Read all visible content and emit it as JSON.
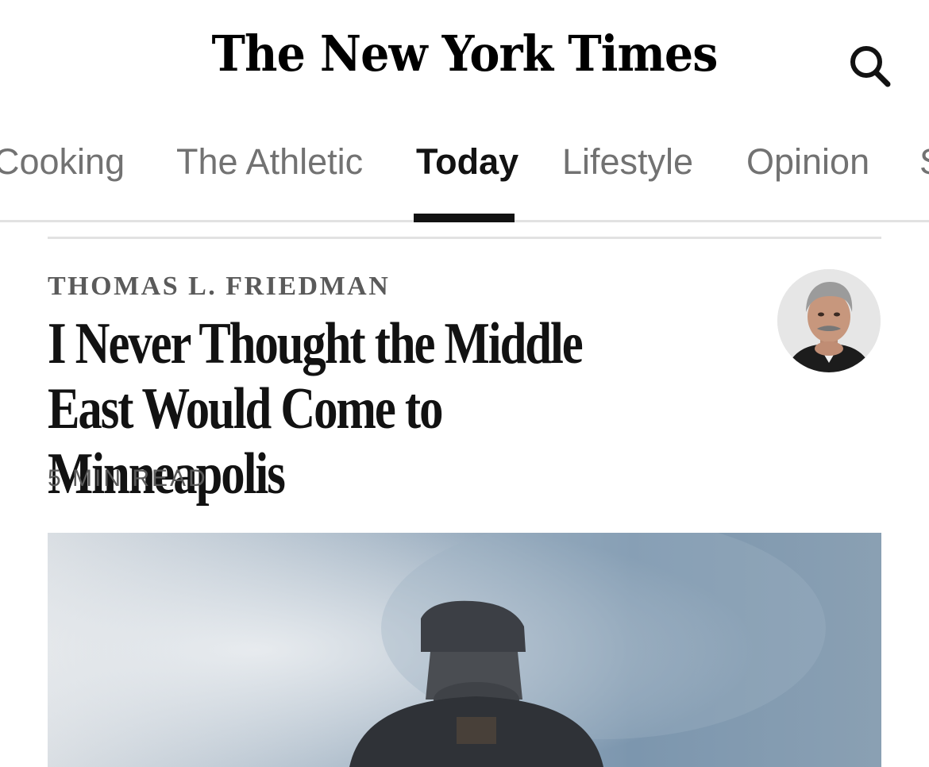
{
  "masthead": {
    "logo_text": "The New York Times",
    "search_icon": "search-icon"
  },
  "section_nav": {
    "items": [
      {
        "label": "Cooking",
        "active": false
      },
      {
        "label": "The Athletic",
        "active": false
      },
      {
        "label": "Today",
        "active": true
      },
      {
        "label": "Lifestyle",
        "active": false
      },
      {
        "label": "Opinion",
        "active": false
      },
      {
        "label": "S",
        "active": false
      }
    ]
  },
  "article": {
    "byline": "THOMAS L. FRIEDMAN",
    "headline": "I Never Thought the Middle East Would Come to Minneapolis",
    "read_time": "5 MIN READ",
    "author_avatar": "author-photo",
    "lead_image": "protest-photo-smoke"
  },
  "colors": {
    "text_primary": "#121212",
    "text_secondary": "#727272",
    "byline_gray": "#5a5a5a",
    "divider": "#e2e2e2",
    "active_indicator": "#121212"
  }
}
